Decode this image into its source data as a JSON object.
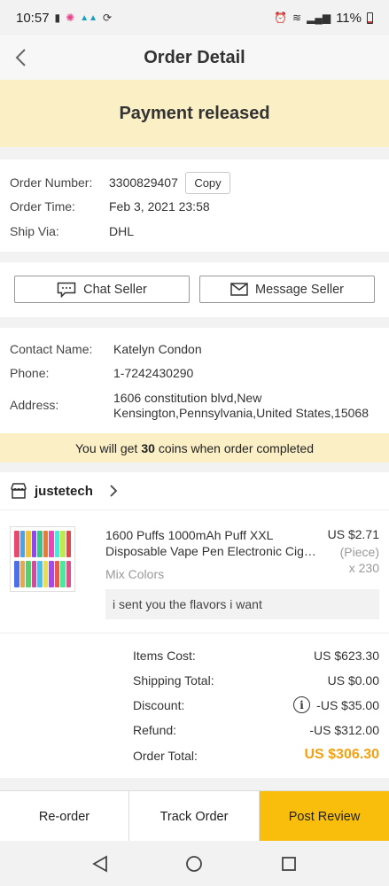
{
  "status_bar": {
    "time": "10:57",
    "battery": "11%",
    "icons": [
      "sim-icon",
      "flower-icon",
      "messenger-icon",
      "sync-icon",
      "alarm-icon",
      "wifi-icon",
      "signal-icon",
      "battery-icon"
    ]
  },
  "header": {
    "title": "Order Detail"
  },
  "banner": {
    "status": "Payment released"
  },
  "order": {
    "number_label": "Order Number:",
    "number": "3300829407",
    "copy_label": "Copy",
    "time_label": "Order Time:",
    "time": "Feb 3, 2021 23:58",
    "ship_label": "Ship Via:",
    "ship": "DHL"
  },
  "contact_buttons": {
    "chat": "Chat Seller",
    "message": "Message Seller"
  },
  "address": {
    "name_label": "Contact Name:",
    "name": "Katelyn Condon",
    "phone_label": "Phone:",
    "phone": "1-7242430290",
    "address_label": "Address:",
    "address_line1": "1606 constitution blvd,New",
    "address_line2": "Kensington,Pennsylvania,United States,15068"
  },
  "coins": {
    "prefix": "You will get",
    "amount": "30",
    "suffix": "coins when order completed"
  },
  "store": {
    "name": "justetech"
  },
  "product": {
    "title_line1": "1600 Puffs 1000mAh Puff XXL",
    "title_line2": "Disposable Vape Pen Electronic Cigarette",
    "sku": "Mix Colors",
    "price": "US $2.71",
    "unit": "(Piece)",
    "qty": "x 230",
    "note": "i sent you the flavors i want"
  },
  "costs": {
    "items_label": "Items Cost:",
    "items": "US $623.30",
    "shipping_label": "Shipping Total:",
    "shipping": "US $0.00",
    "discount_label": "Discount:",
    "discount": "-US $35.00",
    "refund_label": "Refund:",
    "refund": "-US $312.00",
    "total_label": "Order Total:",
    "total": "US $306.30"
  },
  "actions": {
    "reorder": "Re-order",
    "track": "Track Order",
    "review": "Post Review"
  },
  "colors": {
    "accent_yellow": "#f9be0c",
    "banner_bg": "#fbefc6",
    "total_orange": "#f3a112"
  }
}
